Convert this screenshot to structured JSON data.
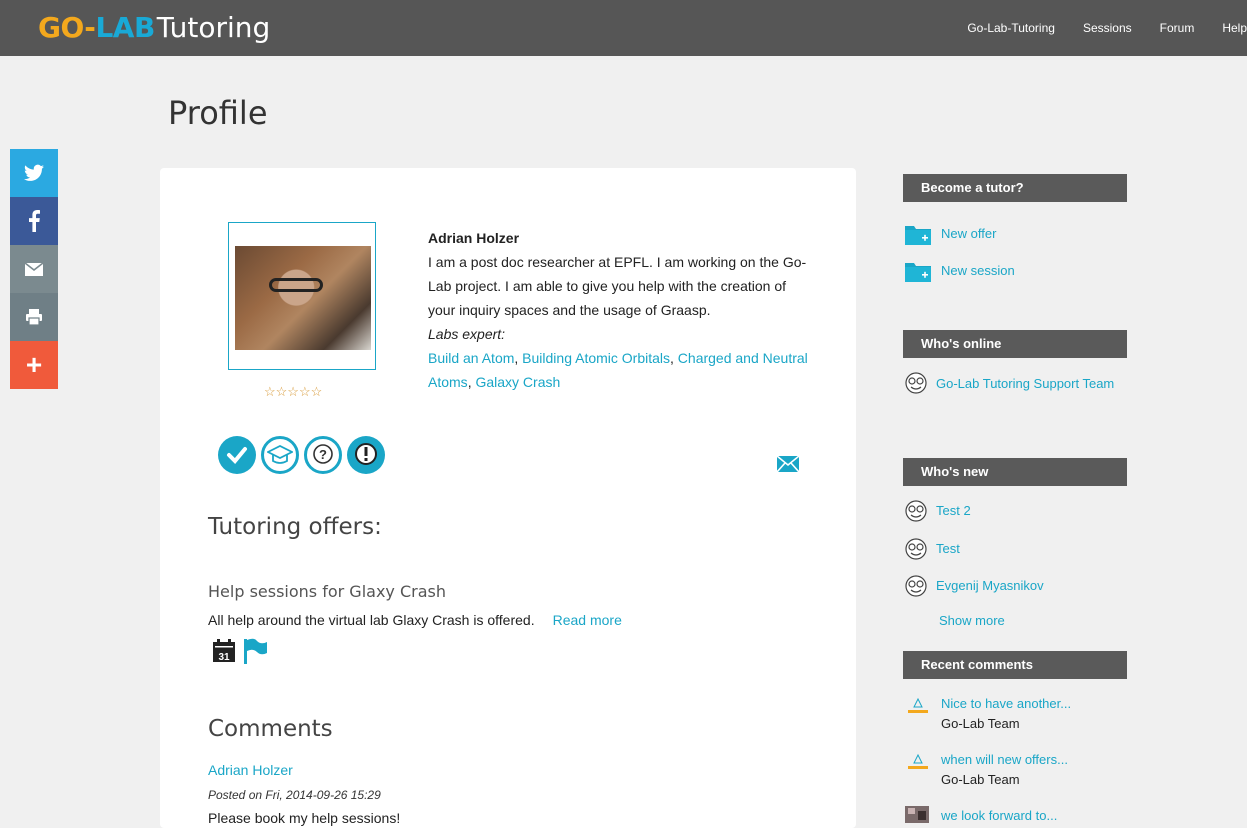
{
  "header": {
    "logo_go": "GO-",
    "logo_lab": "LAB",
    "logo_tutoring": "Tutoring",
    "nav": [
      "Go-Lab-Tutoring",
      "Sessions",
      "Forum",
      "Help"
    ]
  },
  "social": {
    "plus_label": "+"
  },
  "page_title": "Profile",
  "profile": {
    "name": "Adrian Holzer",
    "description": "I am a post doc researcher at EPFL. I am working on the Go-Lab project. I am able to give you help with the creation of your inquiry spaces and the usage of Graasp.",
    "labs_label": "Labs expert:",
    "labs": [
      "Build an Atom",
      "Building Atomic Orbitals",
      "Charged and Neutral Atoms",
      "Galaxy Crash"
    ],
    "rating_stars": "☆☆☆☆☆",
    "rating": 0
  },
  "offers": {
    "heading": "Tutoring offers:",
    "items": [
      {
        "title": "Help sessions for Glaxy Crash",
        "description": "All help around the virtual lab Glaxy Crash is offered.",
        "read_more": "Read more",
        "calendar_day": "31"
      }
    ]
  },
  "comments": {
    "heading": "Comments",
    "items": [
      {
        "author": "Adrian Holzer",
        "posted": "Posted on Fri, 2014-09-26 15:29",
        "body": "Please book my help sessions!"
      }
    ]
  },
  "sidebar": {
    "become_tutor": {
      "title": "Become a tutor?",
      "links": [
        "New offer",
        "New session"
      ]
    },
    "whos_online": {
      "title": "Who's online",
      "users": [
        "Go-Lab Tutoring Support Team"
      ]
    },
    "whos_new": {
      "title": "Who's new",
      "users": [
        "Test 2",
        "Test",
        "Evgenij Myasnikov"
      ],
      "show_more": "Show more"
    },
    "recent_comments": {
      "title": "Recent comments",
      "items": [
        {
          "text": "Nice to have another...",
          "author": "Go-Lab Team"
        },
        {
          "text": "when will new offers...",
          "author": "Go-Lab Team"
        },
        {
          "text": "we look forward to...",
          "author": ""
        }
      ]
    }
  },
  "colors": {
    "accent": "#1aa6c7",
    "header_bg": "#565656",
    "sidebar_title_bg": "#5a5a5a"
  }
}
